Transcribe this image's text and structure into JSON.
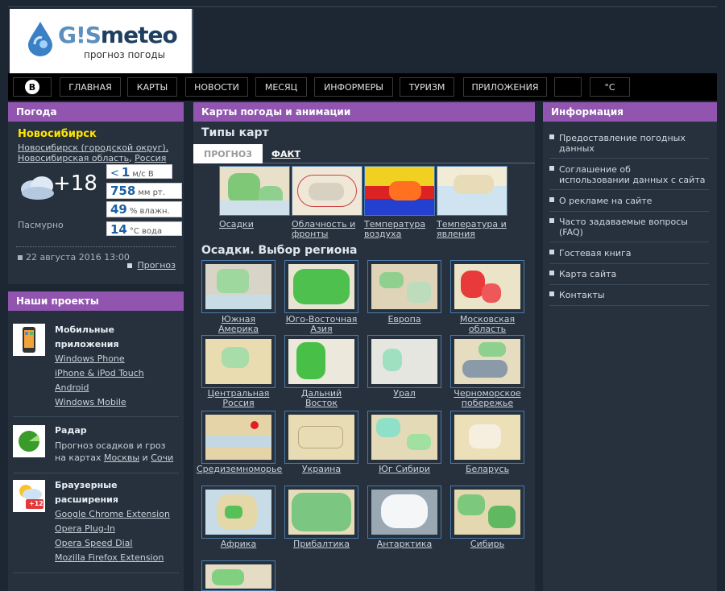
{
  "header": {
    "brand_a": "G!S",
    "brand_b": "meteo",
    "tagline": "прогноз погоды"
  },
  "nav": [
    {
      "label": "β",
      "icon": "beta-icon"
    },
    {
      "label": "Главная"
    },
    {
      "label": "Карты"
    },
    {
      "label": "Новости"
    },
    {
      "label": "Месяц"
    },
    {
      "label": "Информеры"
    },
    {
      "label": "Туризм"
    },
    {
      "label": "Приложения"
    },
    {
      "label": ""
    },
    {
      "label": "°C"
    }
  ],
  "weather": {
    "panel_title": "Погода",
    "city": "Новосибирск",
    "loc1": "Новосибирск (городской округ),",
    "loc2": "Новосибирская область",
    "loc3": "Россия",
    "temp": "+18",
    "wind_value": "1",
    "wind_unit": "м/с  В",
    "pressure_value": "758",
    "pressure_unit": "мм рт.",
    "humidity_value": "49",
    "humidity_unit": "% влажн.",
    "water_value": "14",
    "water_unit": "°C вода",
    "condition": "Пасмурно",
    "date": "22 августа 2016 13:00",
    "forecast_link": "Прогноз"
  },
  "projects": {
    "panel_title": "Наши проекты",
    "mobile_title_1": "Мобильные",
    "mobile_title_2": "приложения",
    "mobile_links": [
      "Windows Phone",
      "iPhone & iPod Touch",
      "Android",
      "Windows Mobile"
    ],
    "radar_title": "Радар",
    "radar_text_1": "Прогноз осадков и гроз",
    "radar_text_2a": "на картах ",
    "radar_link_1": "Москвы",
    "radar_text_2b": " и ",
    "radar_link_2": "Сочи",
    "browser_title_1": "Браузерные",
    "browser_title_2": "расширения",
    "browser_links": [
      "Google Chrome Extension",
      "Opera Plug-In",
      "Opera Speed Dial",
      "Mozilla Firefox Extension"
    ],
    "badge": "+12"
  },
  "maps": {
    "panel_title": "Карты погоды и анимации",
    "types_title": "Типы карт",
    "tab_active": "ПРОГНОЗ",
    "tab_other": "ФАКТ",
    "types": [
      {
        "line1": "Осадки",
        "line2": ""
      },
      {
        "line1": "Облачность и",
        "line2": "фронты"
      },
      {
        "line1": "Температура",
        "line2": "воздуха"
      },
      {
        "line1": "Температура и",
        "line2": "явления"
      }
    ],
    "regions_title": "Осадки. Выбор региона",
    "regions": [
      {
        "line1": "Южная",
        "line2": "Америка"
      },
      {
        "line1": "Юго-Восточная",
        "line2": "Азия"
      },
      {
        "line1": "Европа",
        "line2": ""
      },
      {
        "line1": "Московская",
        "line2": "область"
      },
      {
        "line1": "Центральная",
        "line2": "Россия"
      },
      {
        "line1": "Дальний",
        "line2": "Восток"
      },
      {
        "line1": "Урал",
        "line2": ""
      },
      {
        "line1": "Черноморское",
        "line2": "побережье"
      },
      {
        "line1": "Средиземноморье",
        "line2": ""
      },
      {
        "line1": "Украина",
        "line2": ""
      },
      {
        "line1": "Юг Сибири",
        "line2": ""
      },
      {
        "line1": "Беларусь",
        "line2": ""
      },
      {
        "line1": "Африка",
        "line2": ""
      },
      {
        "line1": "Прибалтика",
        "line2": ""
      },
      {
        "line1": "Антарктика",
        "line2": ""
      },
      {
        "line1": "Сибирь",
        "line2": ""
      }
    ]
  },
  "info": {
    "panel_title": "Информация",
    "items": [
      {
        "line1": "Предоставление погодных",
        "line2": "данных"
      },
      {
        "line1": "Соглашение об",
        "line2": "использовании данных с сайта"
      },
      {
        "line1": "О рекламе на сайте",
        "line2": ""
      },
      {
        "line1": "Часто задаваемые вопросы",
        "line2": "(FAQ)"
      },
      {
        "line1": "Гостевая книга",
        "line2": ""
      },
      {
        "line1": "Карта сайта",
        "line2": ""
      },
      {
        "line1": "Контакты",
        "line2": ""
      }
    ]
  }
}
